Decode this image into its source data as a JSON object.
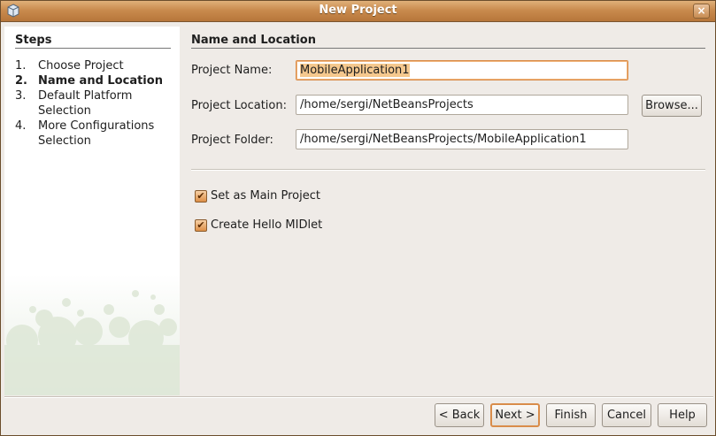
{
  "window": {
    "title": "New Project"
  },
  "steps": {
    "heading": "Steps",
    "items": [
      {
        "num": "1.",
        "label": "Choose Project"
      },
      {
        "num": "2.",
        "label": "Name and Location"
      },
      {
        "num": "3.",
        "label": "Default Platform Selection"
      },
      {
        "num": "4.",
        "label": "More Configurations Selection"
      }
    ],
    "active_index": 1
  },
  "main": {
    "heading": "Name and Location",
    "project_name": {
      "label": "Project Name:",
      "value": "MobileApplication1"
    },
    "project_location": {
      "label": "Project Location:",
      "value": "/home/sergi/NetBeansProjects"
    },
    "project_folder": {
      "label": "Project Folder:",
      "value": "/home/sergi/NetBeansProjects/MobileApplication1"
    },
    "browse_label": "Browse...",
    "set_main_project": {
      "label": "Set as Main Project",
      "checked": true
    },
    "create_hello_midlet": {
      "label": "Create Hello MIDlet",
      "checked": true
    }
  },
  "buttons": {
    "back": "< Back",
    "next": "Next >",
    "finish": "Finish",
    "cancel": "Cancel",
    "help": "Help"
  },
  "colors": {
    "accent": "#d98c4a",
    "titlebar": "#c98b4e",
    "dialog_bg": "#efebe7"
  },
  "icons": {
    "app": "netbeans-cube-icon",
    "close": "close-icon",
    "check": "checkmark-icon"
  }
}
